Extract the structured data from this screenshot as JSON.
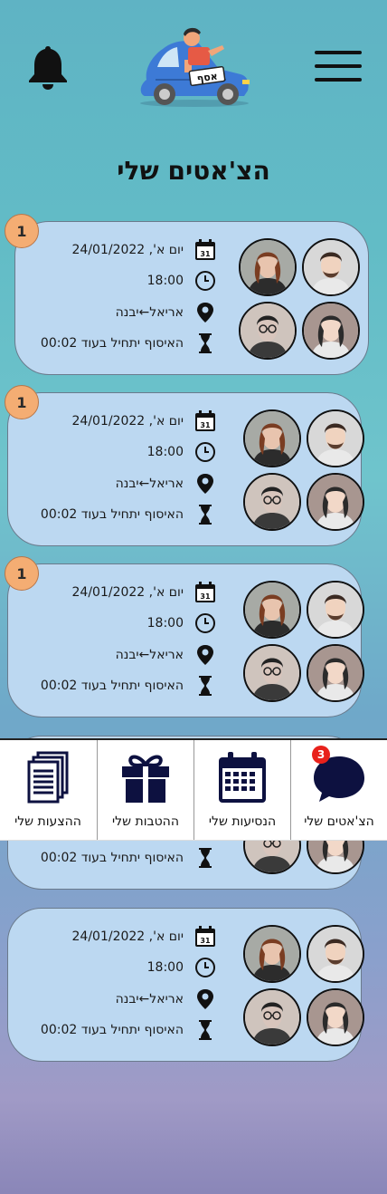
{
  "header": {
    "title": "הצ'אטים שלי",
    "logo_plate": "אסף"
  },
  "chats": [
    {
      "badge": "1",
      "date": "יום א', 24/01/2022",
      "time": "18:00",
      "route": "אריאל←יבנה",
      "pickup": "האיסוף יתחיל בעוד 00:02"
    },
    {
      "badge": "1",
      "date": "יום א', 24/01/2022",
      "time": "18:00",
      "route": "אריאל←יבנה",
      "pickup": "האיסוף יתחיל בעוד 00:02"
    },
    {
      "badge": "1",
      "date": "יום א', 24/01/2022",
      "time": "18:00",
      "route": "אריאל←יבנה",
      "pickup": "האיסוף יתחיל בעוד 00:02"
    },
    {
      "pickup": "האיסוף יתחיל בעוד 00:02"
    },
    {
      "date": "יום א', 24/01/2022",
      "time": "18:00",
      "route": "אריאל←יבנה",
      "pickup": "האיסוף יתחיל בעוד 00:02"
    }
  ],
  "calendar_day": "31",
  "bottom_nav": {
    "chats": {
      "label": "הצ'אטים שלי",
      "count": "3"
    },
    "rides": {
      "label": "הנסיעות שלי"
    },
    "perks": {
      "label": "ההטבות שלי"
    },
    "offers": {
      "label": "ההצעות שלי"
    }
  },
  "colors": {
    "card": "#bcd8f1",
    "badge": "#f4ad73",
    "notification": "#e8211b",
    "navy_icon": "#0d1140"
  }
}
